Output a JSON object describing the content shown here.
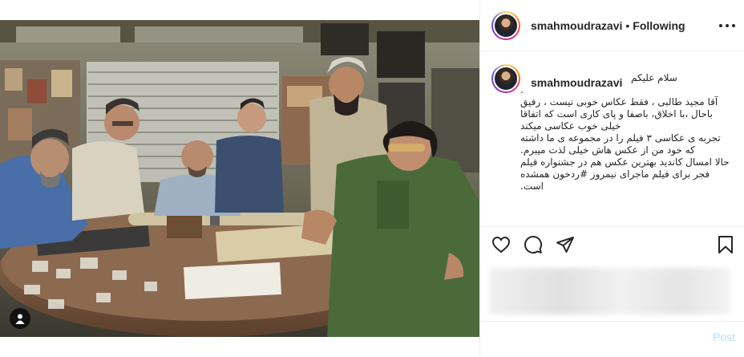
{
  "post": {
    "username": "smahmoudrazavi",
    "dot": "•",
    "follow_label": "Following",
    "caption_username": "smahmoudrazavi",
    "caption_lines": [
      "سلام علیکم",
      ".",
      "آقا مجید طالبی ، فقط عکاس خوبی نیست ، رفیق",
      "باحال ،با اخلاق، باصفا و پای کاری است که اتفاقا",
      "خیلی خوب عکاسی میکند",
      "تجربه ی عکاسی ۳ فیلم را در مجموعه ی ما داشته",
      "که خود من از عکس هاش خیلی لذت میبرم.",
      "حالا امسال کاندید بهترین عکس هم در جشنواره فیلم",
      "فجر برای فیلم ماجرای نیمروز #ردخون همشده",
      "است."
    ],
    "comment_placeholder": "",
    "post_label": "Post"
  },
  "icons": {
    "more": "more-options-icon",
    "like": "heart-icon",
    "comment": "comment-bubble-icon",
    "share": "paper-plane-icon",
    "save": "bookmark-icon",
    "tag": "user-tag-icon"
  },
  "colors": {
    "text": "#262626",
    "border": "#efefef",
    "post_button": "#b2dffc"
  }
}
